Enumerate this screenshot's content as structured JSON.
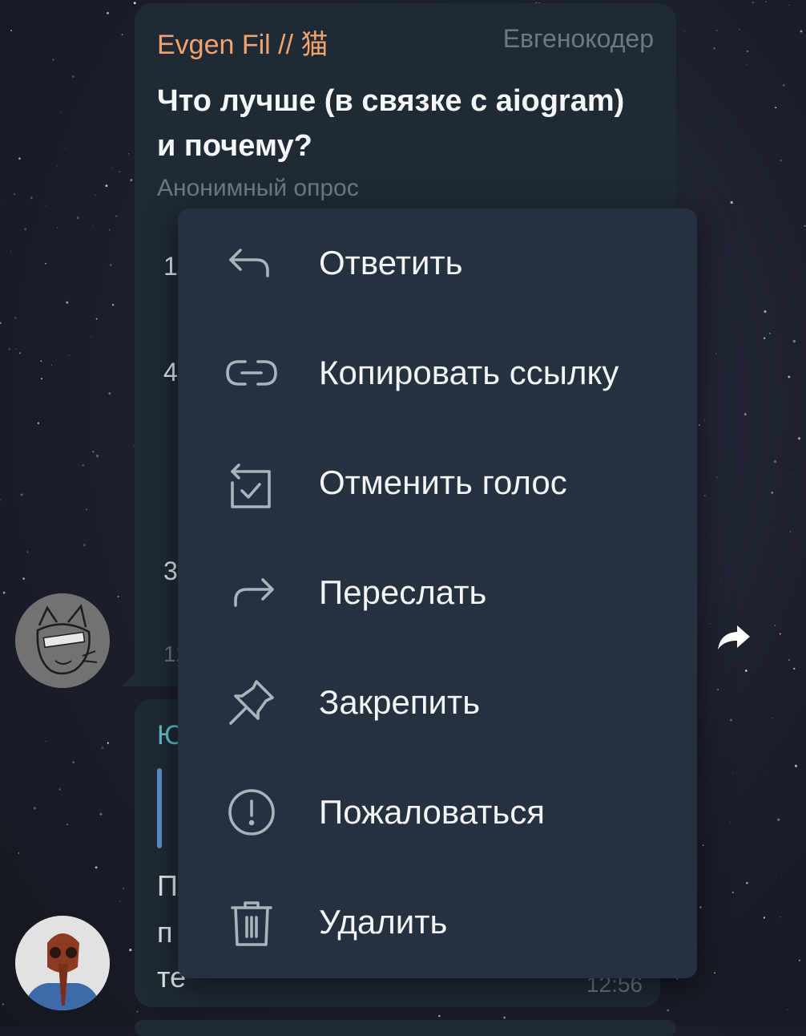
{
  "poll_message": {
    "sender": "Evgen Fil // 猫",
    "channel": "Евгенокодер",
    "question": "Что лучше (в связке с aiogram) и почему?",
    "poll_type": "Анонимный опрос",
    "partial_options": [
      "1",
      "4",
      "3"
    ],
    "partial_footer": "12"
  },
  "reply_message": {
    "partial_name": "Ю",
    "partial_lines": [
      "П",
      "п",
      "те"
    ],
    "time": "12:56"
  },
  "context_menu": {
    "items": [
      {
        "label": "Ответить",
        "icon": "reply-icon"
      },
      {
        "label": "Копировать ссылку",
        "icon": "link-icon"
      },
      {
        "label": "Отменить голос",
        "icon": "retract-vote-icon"
      },
      {
        "label": "Переслать",
        "icon": "forward-icon"
      },
      {
        "label": "Закрепить",
        "icon": "pin-icon"
      },
      {
        "label": "Пожаловаться",
        "icon": "report-icon"
      },
      {
        "label": "Удалить",
        "icon": "delete-icon"
      }
    ]
  },
  "colors": {
    "sender_name": "#f0a36c",
    "menu_background": "#26313f",
    "bubble_background": "#1f2a36",
    "reply_name": "#5fc1c8"
  }
}
